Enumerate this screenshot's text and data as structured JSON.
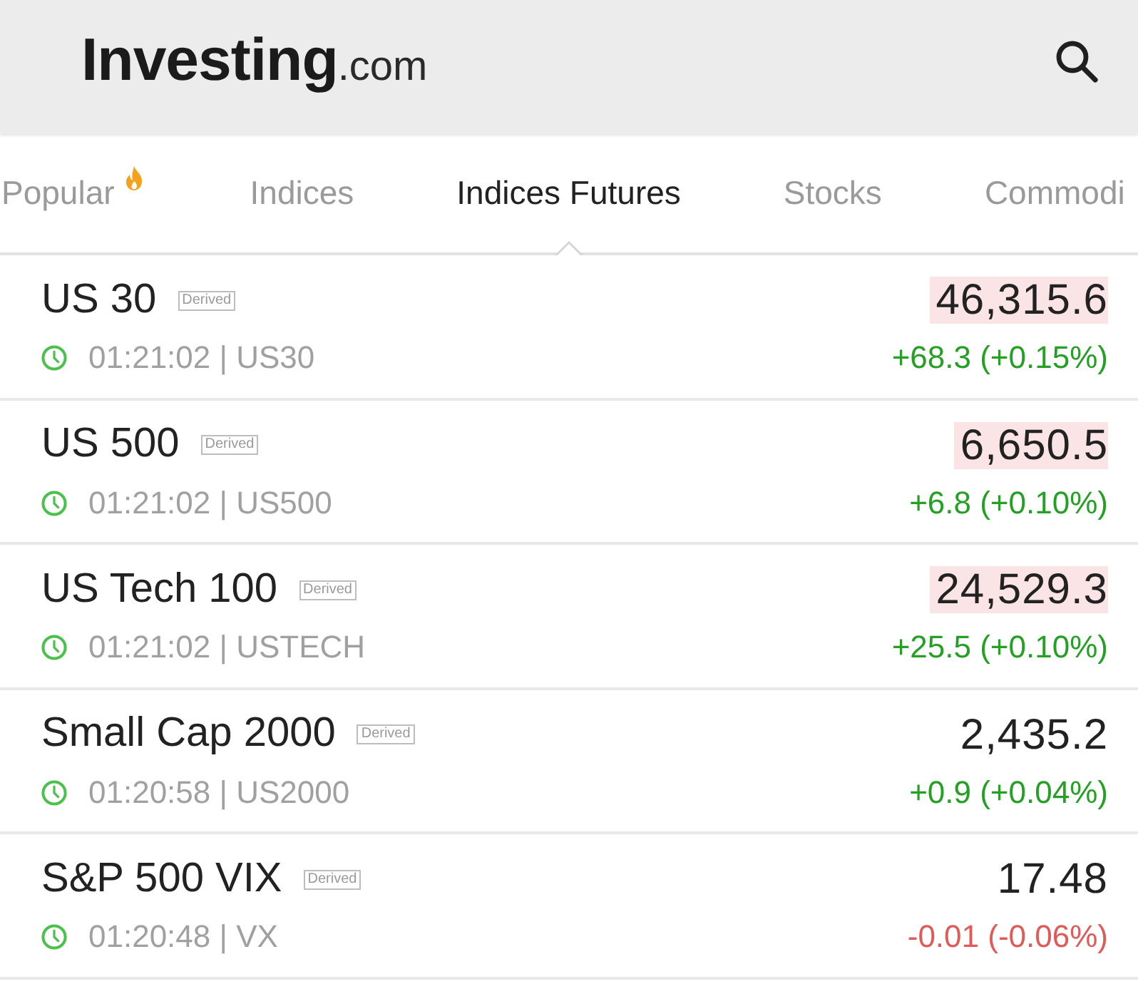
{
  "header": {
    "logo": "**Investing**.com"
  },
  "tabs": [
    {
      "label": "Popular",
      "selected": false,
      "hot": true
    },
    {
      "label": "Indices",
      "selected": false,
      "hot": false
    },
    {
      "label": "Indices Futures",
      "selected": true,
      "hot": false
    },
    {
      "label": "Stocks",
      "selected": false,
      "hot": false
    },
    {
      "label": "Commodi",
      "selected": false,
      "hot": false
    }
  ],
  "quotes": [
    {
      "name": "US 30",
      "badge": "Derived",
      "meta": "01:21:02 | US30",
      "price": "46,315.6",
      "flash": true,
      "change": "+68.3 (+0.15%)",
      "rising": true
    },
    {
      "name": "US 500",
      "badge": "Derived",
      "meta": "01:21:02 | US500",
      "price": "6,650.5",
      "flash": true,
      "change": "+6.8 (+0.10%)",
      "rising": true
    },
    {
      "name": "US Tech 100",
      "badge": "Derived",
      "meta": "01:21:02 | USTECH",
      "price": "24,529.3",
      "flash": true,
      "change": "+25.5 (+0.10%)",
      "rising": true
    },
    {
      "name": "Small Cap 2000",
      "badge": "Derived",
      "meta": "01:20:58 | US2000",
      "price": "2,435.2",
      "flash": false,
      "change": "+0.9 (+0.04%)",
      "rising": true
    },
    {
      "name": "S&P 500 VIX",
      "badge": "Derived",
      "meta": "01:20:48 | VX",
      "price": "17.48",
      "flash": false,
      "change": "-0.01 (-0.06%)",
      "rising": false
    }
  ]
}
